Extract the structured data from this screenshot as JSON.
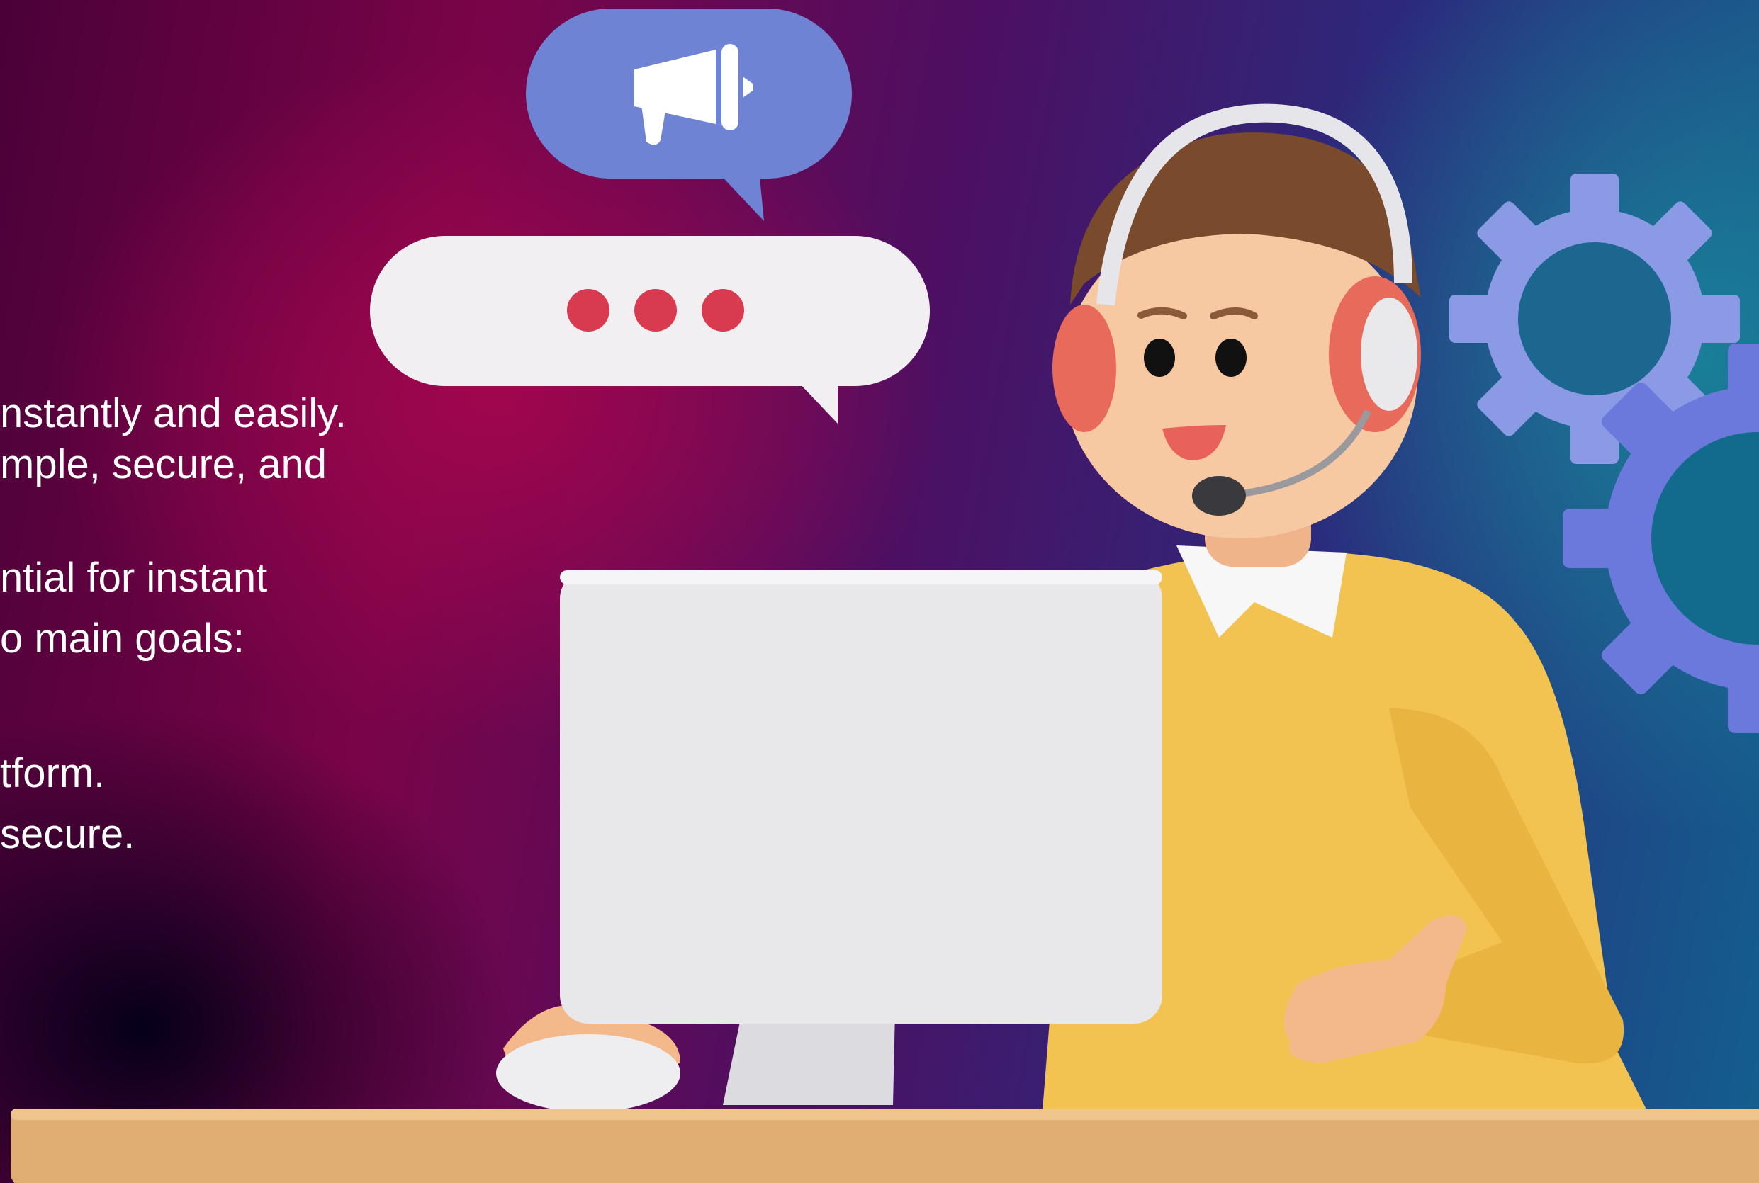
{
  "slide": {
    "text_lines": [
      "nstantly and easily.",
      "mple, secure, and",
      "ntial for instant",
      "o main goals:",
      "tform.",
      "secure."
    ]
  },
  "illustration": {
    "elements": [
      "megaphone-speech-bubble",
      "typing-speech-bubble",
      "support-agent-with-headset",
      "desktop-monitor",
      "computer-mouse",
      "gear-icons",
      "desk"
    ]
  },
  "colors": {
    "megaphone_bubble": "#6f83d4",
    "typing_bubble": "#f1eff1",
    "typing_dots": "#d83a4f",
    "sweater": "#f2c350",
    "monitor": "#e8e7ea",
    "headset_cushion": "#e86a5a",
    "hair": "#7a4a2c",
    "skin": "#f7c9a3",
    "gear": "#8b9be6",
    "desk": "#e0ad72"
  }
}
